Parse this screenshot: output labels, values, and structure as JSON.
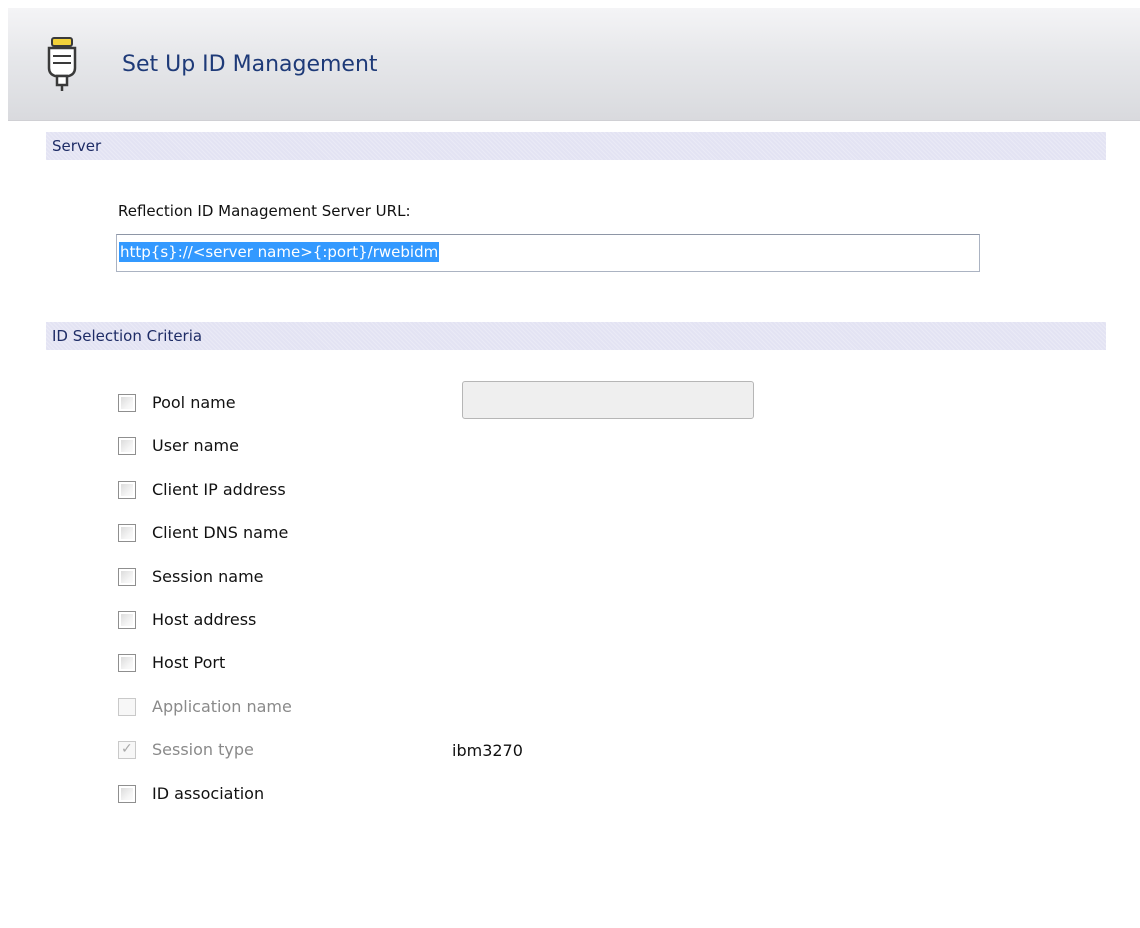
{
  "header": {
    "title": "Set Up ID Management",
    "icon": "connector-plug-icon"
  },
  "server_section": {
    "title": "Server",
    "url_label": "Reflection ID Management Server URL:",
    "url_value": "http{s}://<server name>{:port}/rwebidm"
  },
  "criteria_section": {
    "title": "ID Selection Criteria",
    "items": [
      {
        "label": "Pool name",
        "checked": false,
        "enabled": true
      },
      {
        "label": "User name",
        "checked": false,
        "enabled": true
      },
      {
        "label": "Client IP address",
        "checked": false,
        "enabled": true
      },
      {
        "label": "Client DNS name",
        "checked": false,
        "enabled": true
      },
      {
        "label": "Session name",
        "checked": false,
        "enabled": true
      },
      {
        "label": "Host address",
        "checked": false,
        "enabled": true
      },
      {
        "label": "Host Port",
        "checked": false,
        "enabled": true
      },
      {
        "label": "Application name",
        "checked": false,
        "enabled": false
      },
      {
        "label": "Session type",
        "checked": true,
        "enabled": false
      },
      {
        "label": "ID association",
        "checked": false,
        "enabled": true
      }
    ],
    "pool_name_value": "",
    "session_type_value": "ibm3270"
  },
  "colors": {
    "title_blue": "#1e3a78",
    "section_bar": "#e3e3f3",
    "selection": "#3399ff"
  }
}
